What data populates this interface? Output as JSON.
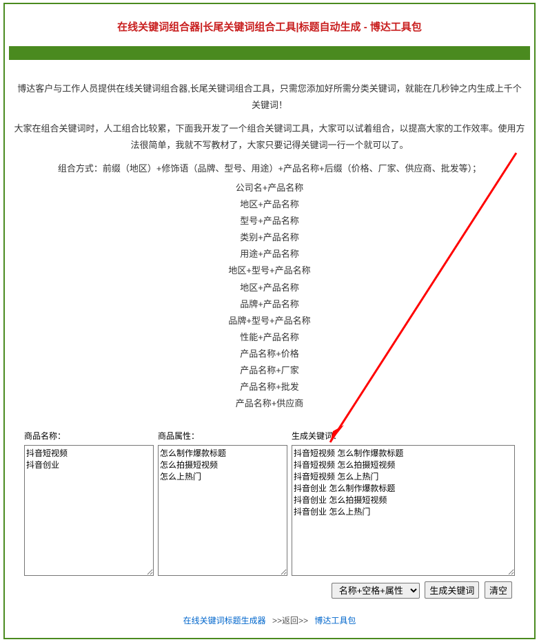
{
  "title": "在线关键词组合器|长尾关键词组合工具|标题自动生成 - 博达工具包",
  "intro1": "博达客户与工作人员提供在线关键词组合器,长尾关键词组合工具，只需您添加好所需分类关键词，就能在几秒钟之内生成上千个关键词！",
  "intro2": "大家在组合关键词时，人工组合比较累，下面我开发了一个组合关键词工具，大家可以试着组合，以提高大家的工作效率。使用方法很简单，我就不写教材了，大家只要记得关键词一行一个就可以了。",
  "method_header": "组合方式：前缀（地区）+修饰语（品牌、型号、用途）+产品名称+后缀（价格、厂家、供应商、批发等）；",
  "methods": [
    "公司名+产品名称",
    "地区+产品名称",
    "型号+产品名称",
    "类别+产品名称",
    "用途+产品名称",
    "地区+型号+产品名称",
    "地区+产品名称",
    "品牌+产品名称",
    "品牌+型号+产品名称",
    "性能+产品名称",
    "产品名称+价格",
    "产品名称+厂家",
    "产品名称+批发",
    "产品名称+供应商"
  ],
  "labels": {
    "col1": "商品名称：",
    "col2": "商品属性：",
    "col3": "生成关键词："
  },
  "values": {
    "names": "抖音短视频\n抖音创业",
    "attrs": "怎么制作爆款标题\n怎么拍摄短视频\n怎么上热门",
    "result": "抖音短视频 怎么制作爆款标题\n抖音短视频 怎么拍摄短视频\n抖音短视频 怎么上热门\n抖音创业 怎么制作爆款标题\n抖音创业 怎么拍摄短视频\n抖音创业 怎么上热门"
  },
  "controls": {
    "select_option": "名称+空格+属性",
    "generate": "生成关键词",
    "clear": "清空"
  },
  "footer": {
    "link1": "在线关键词标题生成器",
    "sep": ">>返回>>",
    "link2": "博达工具包"
  }
}
